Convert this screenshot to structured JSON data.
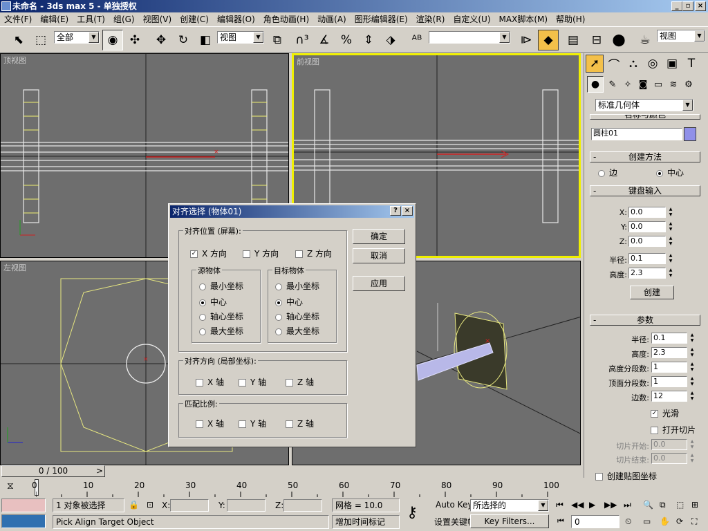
{
  "window": {
    "title": "未命名 - 3ds max 5 - 单独授权"
  },
  "menu": [
    "文件(F)",
    "编辑(E)",
    "工具(T)",
    "组(G)",
    "视图(V)",
    "创建(C)",
    "编辑器(O)",
    "角色动画(H)",
    "动画(A)",
    "图形编辑器(E)",
    "渲染(R)",
    "自定义(U)",
    "MAX脚本(M)",
    "帮助(H)"
  ],
  "toolbar": {
    "selection_filter": "全部",
    "ref_coord": "视图",
    "named_selection": "",
    "render_viewport": "视图"
  },
  "viewports": {
    "top": "顶视图",
    "front": "前视图",
    "left": "左视图"
  },
  "command_panel": {
    "category": "标准几何体",
    "name_color_title": "名称与颜色",
    "object_name": "圆柱01",
    "object_color": "#9090e8",
    "creation_method": {
      "title": "创建方法",
      "edge": "边",
      "center": "中心",
      "selected": "center"
    },
    "keyboard": {
      "title": "键盘输入",
      "x_label": "X:",
      "x": "0.0",
      "y_label": "Y:",
      "y": "0.0",
      "z_label": "Z:",
      "z": "0.0",
      "radius_label": "半径:",
      "radius": "0.1",
      "height_label": "高度:",
      "height": "2.3",
      "create_btn": "创建"
    },
    "params": {
      "title": "参数",
      "radius_label": "半径:",
      "radius": "0.1",
      "height_label": "高度:",
      "height": "2.3",
      "hseg_label": "高度分段数:",
      "hseg": "1",
      "cseg_label": "顶面分段数:",
      "cseg": "1",
      "sides_label": "边数:",
      "sides": "12",
      "smooth_label": "光滑",
      "smooth": true,
      "slice_on_label": "打开切片",
      "slice_on": false,
      "slice_from_label": "切片开始:",
      "slice_from": "0.0",
      "slice_to_label": "切片结束:",
      "slice_to": "0.0",
      "gen_map_label": "创建贴图坐标",
      "gen_map": false
    }
  },
  "dialog": {
    "title": "对齐选择 (物体01)",
    "ok": "确定",
    "cancel": "取消",
    "apply": "应用",
    "pos_group": "对齐位置 (屏幕):",
    "x_pos": "X 方向",
    "y_pos": "Y 方向",
    "z_pos": "Z 方向",
    "x_pos_checked": true,
    "y_pos_checked": false,
    "z_pos_checked": false,
    "source_group": "源物体",
    "target_group": "目标物体",
    "options": [
      "最小坐标",
      "中心",
      "轴心坐标",
      "最大坐标"
    ],
    "source_selected": "中心",
    "target_selected": "中心",
    "orient_group": "对齐方向 (局部坐标):",
    "x_axis": "X 轴",
    "y_axis": "Y 轴",
    "z_axis": "Z 轴",
    "scale_group": "匹配比例:"
  },
  "timeline": {
    "frame": "0 / 100",
    "ticks": [
      "0",
      "10",
      "20",
      "30",
      "40",
      "50",
      "60",
      "70",
      "80",
      "90",
      "100"
    ]
  },
  "status": {
    "selection": "1 对象被选择",
    "prompt": "Pick Align Target Object",
    "x_label": "X:",
    "y_label": "Y:",
    "z_label": "Z:",
    "grid": "网格 = 10.0",
    "add_time_tag": "增加时间标记",
    "auto_key": "Auto Key",
    "set_key": "设置关键帧",
    "key_mode": "所选择的",
    "key_filters": "Key Filters...",
    "current_frame": "0"
  }
}
